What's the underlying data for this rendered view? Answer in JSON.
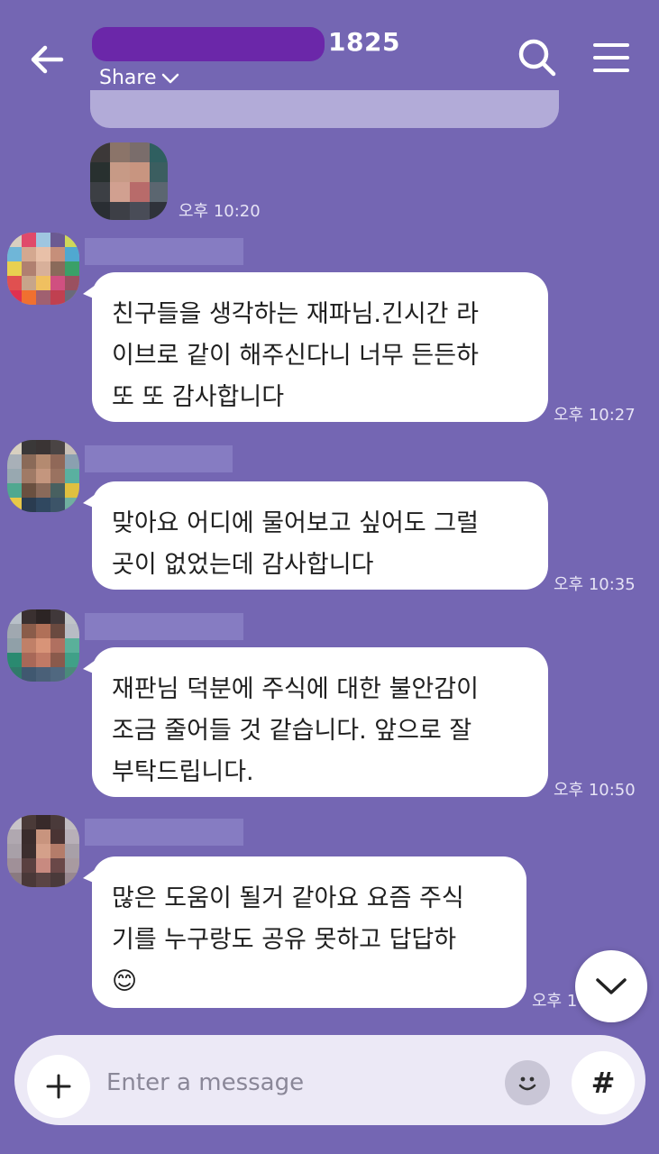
{
  "header": {
    "member_count": "1825",
    "share_label": "Share",
    "icons": [
      "back-arrow-icon",
      "chevron-down-icon",
      "search-icon",
      "menu-icon"
    ]
  },
  "messages": [
    {
      "type": "photo",
      "time": "오후 10:20"
    },
    {
      "type": "text",
      "text": "친구들을 생각하는 재파님.긴시간 라\n이브로 같이 해주신다니 너무 든든하\n또 또 감사합니다",
      "time": "오후 10:27"
    },
    {
      "type": "text",
      "text": "맞아요 어디에 물어보고 싶어도 그럴\n곳이 없었는데 감사합니다",
      "time": "오후 10:35"
    },
    {
      "type": "text",
      "text": "재판님 덕분에 주식에 대한 불안감이\n조금 줄어들 것 같습니다. 앞으로 잘\n부탁드립니다.",
      "time": "오후 10:50"
    },
    {
      "type": "text",
      "text": "많은 도움이 될거 같아요 요즘 주식\n기를 누구랑도 공유 못하고 답답하\n😊",
      "time": "오후 1"
    }
  ],
  "input": {
    "placeholder": "Enter a message",
    "hash_label": "#"
  },
  "colors": {
    "background": "#7466b3",
    "bubble": "#ffffff",
    "input_bar": "#ece9f6"
  }
}
